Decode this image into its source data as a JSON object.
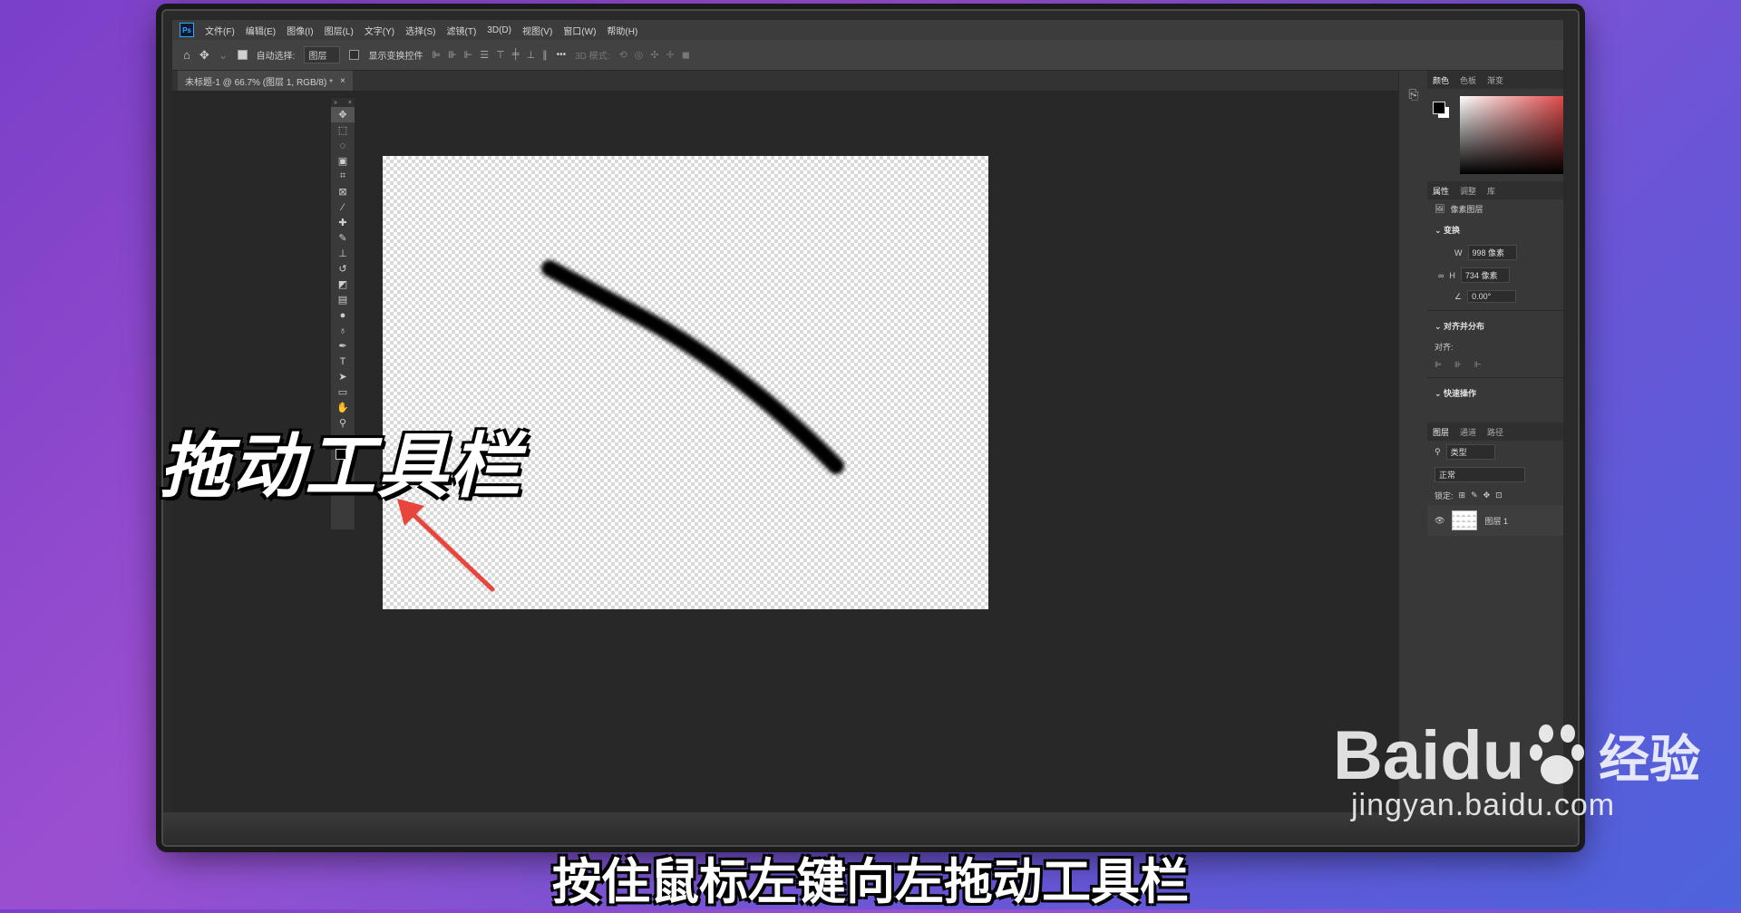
{
  "menubar": {
    "logo": "Ps",
    "items": [
      "文件(F)",
      "编辑(E)",
      "图像(I)",
      "图层(L)",
      "文字(Y)",
      "选择(S)",
      "滤镜(T)",
      "3D(D)",
      "视图(V)",
      "窗口(W)",
      "帮助(H)"
    ]
  },
  "options": {
    "auto_select_label": "自动选择:",
    "auto_select_value": "图层",
    "show_transform_label": "显示变换控件",
    "more": "•••",
    "mode_3d_label": "3D 模式:"
  },
  "document_tab": {
    "title": "未标题-1 @ 66.7% (图层 1, RGB/8) *",
    "close": "×"
  },
  "panels": {
    "color_tabs": [
      "颜色",
      "色板",
      "渐变"
    ],
    "props_tabs": [
      "属性",
      "调整",
      "库"
    ],
    "pixel_layer": "像素图层",
    "transform_label": "变换",
    "w_label": "W",
    "w_value": "998 像素",
    "h_label": "H",
    "h_value": "734 像素",
    "angle_value": "0.00°",
    "align_label": "对齐并分布",
    "align_sub": "对齐:",
    "quick_actions": "快速操作",
    "layer_tabs": [
      "图层",
      "通道",
      "路径"
    ],
    "filter_kind": "类型",
    "blend_mode": "正常",
    "lock_label": "锁定:",
    "layer_name": "图层 1"
  },
  "overlay": {
    "title": "拖动工具栏",
    "caption": "按住鼠标左键向左拖动工具栏"
  },
  "watermark": {
    "brand": "Baidu",
    "brand_cn": "经验",
    "url": "jingyan.baidu.com"
  },
  "colors": {
    "accent_arrow": "#e8453c",
    "canvas_stroke": "#000000"
  }
}
